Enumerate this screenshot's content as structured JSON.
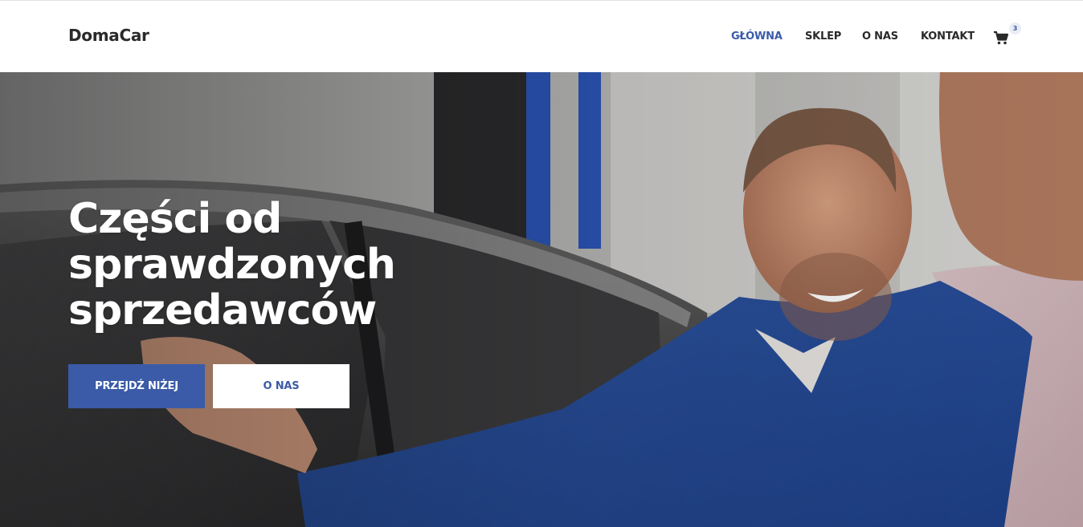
{
  "header": {
    "logo": "DomaCar",
    "nav": [
      "GŁÓWNA",
      "SKLEP",
      "O NAS",
      "KONTAKT"
    ],
    "active_index": 0,
    "cart_count": "3",
    "cart_icon": "shopping-cart-icon"
  },
  "hero": {
    "headline_lines": [
      "Części od",
      "sprawdzonych",
      "sprzedawców"
    ],
    "primary_button": "PRZEJDŹ NIŻEJ",
    "secondary_button": "O NAS",
    "image": "mechanic-and-customer-by-car-photo"
  },
  "colors": {
    "accent": "#3b5ba8",
    "header_bg": "#ffffff",
    "text_dark": "#2a2a2a"
  }
}
